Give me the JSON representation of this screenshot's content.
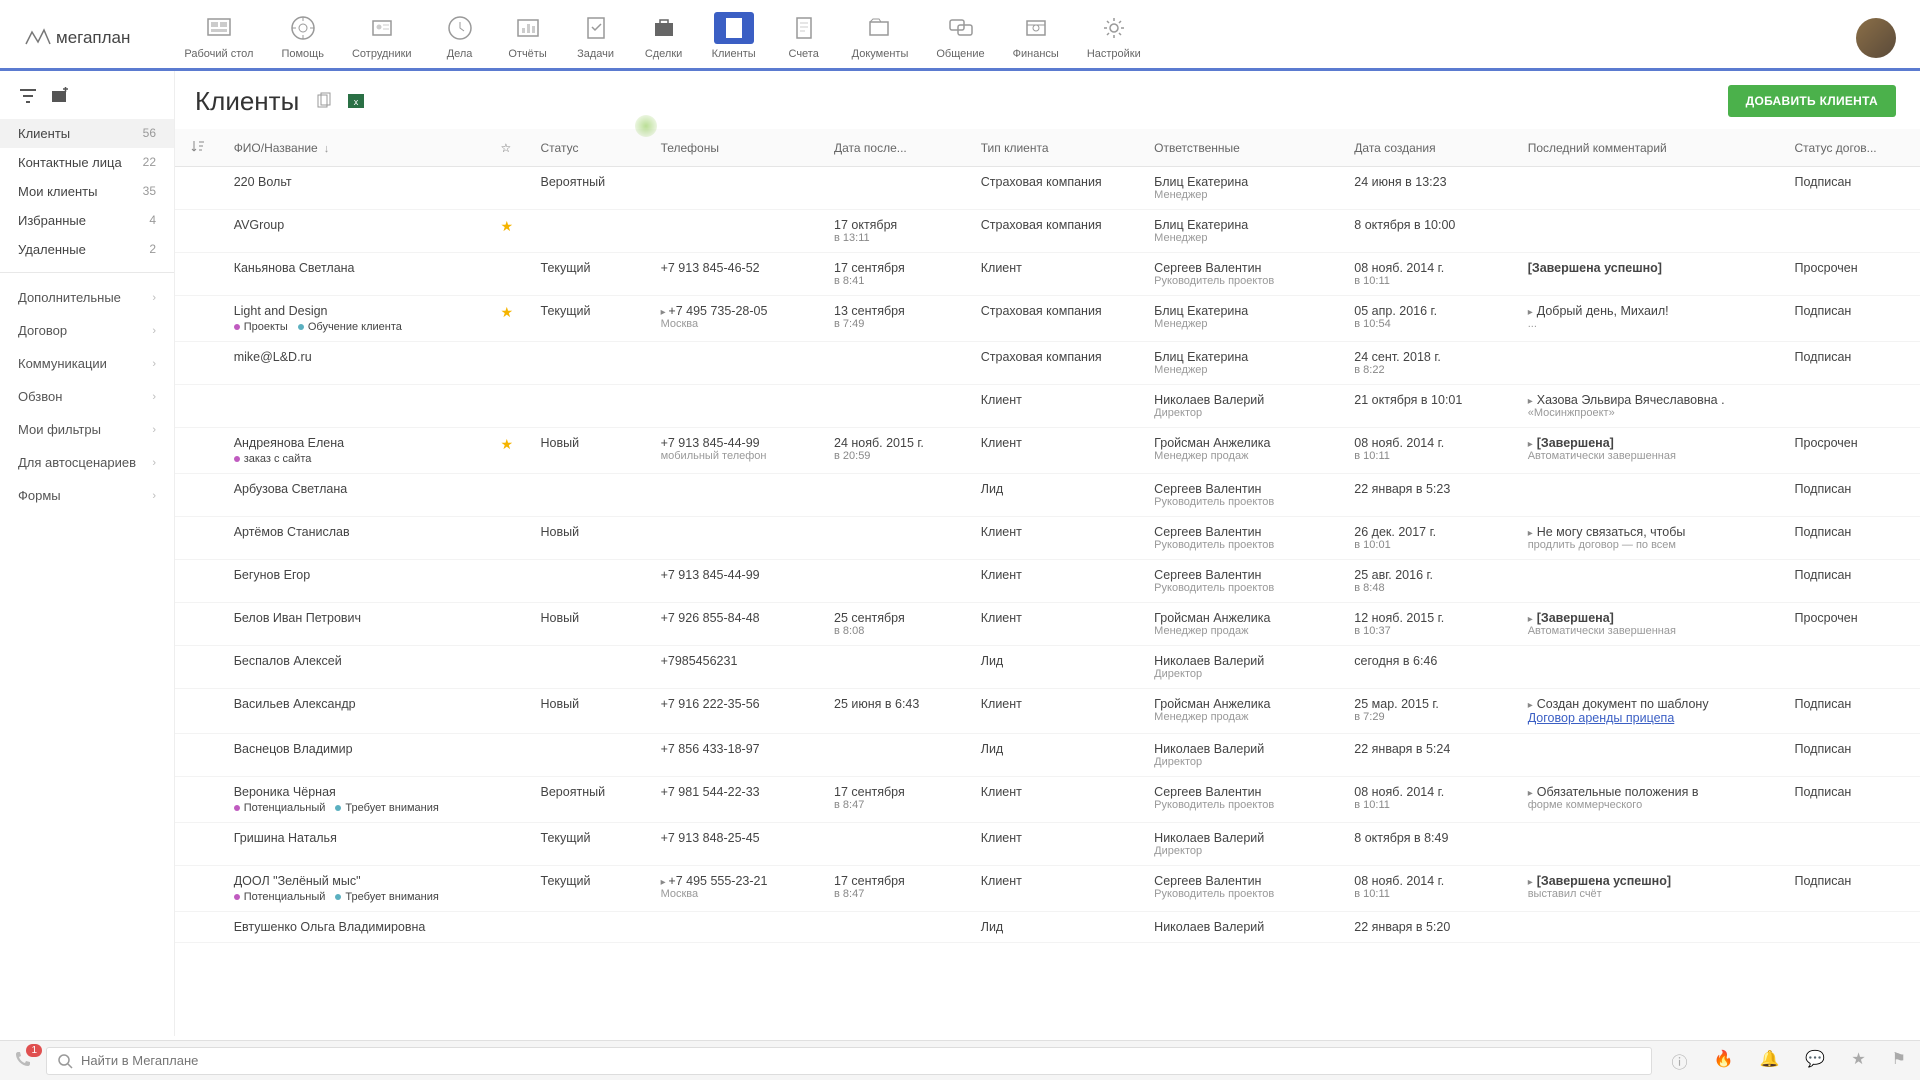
{
  "logo_text": "мегаплан",
  "nav": [
    {
      "id": "desktop",
      "label": "Рабочий стол"
    },
    {
      "id": "help",
      "label": "Помощь"
    },
    {
      "id": "staff",
      "label": "Сотрудники"
    },
    {
      "id": "todo",
      "label": "Дела"
    },
    {
      "id": "reports",
      "label": "Отчёты"
    },
    {
      "id": "tasks",
      "label": "Задачи"
    },
    {
      "id": "deals",
      "label": "Сделки"
    },
    {
      "id": "clients",
      "label": "Клиенты",
      "active": true
    },
    {
      "id": "invoices",
      "label": "Счета"
    },
    {
      "id": "docs",
      "label": "Документы"
    },
    {
      "id": "chat",
      "label": "Общение"
    },
    {
      "id": "finance",
      "label": "Финансы"
    },
    {
      "id": "settings",
      "label": "Настройки"
    }
  ],
  "sidebar": {
    "folders": [
      {
        "label": "Клиенты",
        "count": "56",
        "active": true
      },
      {
        "label": "Контактные лица",
        "count": "22"
      },
      {
        "label": "Мои клиенты",
        "count": "35"
      },
      {
        "label": "Избранные",
        "count": "4"
      },
      {
        "label": "Удаленные",
        "count": "2"
      }
    ],
    "filters": [
      {
        "label": "Дополнительные"
      },
      {
        "label": "Договор"
      },
      {
        "label": "Коммуникации"
      },
      {
        "label": "Обзвон"
      },
      {
        "label": "Мои фильтры"
      },
      {
        "label": "Для автосценариев"
      },
      {
        "label": "Формы"
      }
    ]
  },
  "page_title": "Клиенты",
  "add_button": "ДОБАВИТЬ КЛИЕНТА",
  "columns": {
    "name": "ФИО/Название",
    "status": "Статус",
    "phone": "Телефоны",
    "last": "Дата после...",
    "type": "Тип клиента",
    "resp": "Ответственные",
    "created": "Дата создания",
    "comment": "Последний комментарий",
    "contract": "Статус догов..."
  },
  "rows": [
    {
      "name": "220 Вольт",
      "status": "Вероятный",
      "type": "Страховая компания",
      "resp": "Блиц Екатерина",
      "resp_sub": "Менеджер",
      "created": "24 июня в 13:23",
      "contract": "Подписан"
    },
    {
      "name": "AVGroup",
      "star": true,
      "last": "17 октября",
      "last_sub": "в 13:11",
      "type": "Страховая компания",
      "resp": "Блиц Екатерина",
      "resp_sub": "Менеджер",
      "created": "8 октября в 10:00"
    },
    {
      "name": "Каньянова Светлана",
      "status": "Текущий",
      "phone": "+7 913 845-46-52",
      "last": "17 сентября",
      "last_sub": "в 8:41",
      "type": "Клиент",
      "resp": "Сергеев Валентин",
      "resp_sub": "Руководитель проектов",
      "created": "08 нояб. 2014 г.",
      "created_sub": "в 10:11",
      "comment": "[Завершена успешно]",
      "bold_comment": true,
      "contract": "Просрочен"
    },
    {
      "name": "Light and Design",
      "tags": [
        {
          "t": "Проекты",
          "c": "#c05bc0"
        },
        {
          "t": "Обучение клиента",
          "c": "#5bb0c0"
        }
      ],
      "star": true,
      "status": "Текущий",
      "phone": "+7 495 735-28-05",
      "phone_sub": "Москва",
      "phone_arrow": true,
      "last": "13 сентября",
      "last_sub": "в 7:49",
      "type": "Страховая компания",
      "resp": "Блиц Екатерина",
      "resp_sub": "Менеджер",
      "created": "05 апр. 2016 г.",
      "created_sub": "в 10:54",
      "comment": "Добрый день, Михаил!",
      "comment_sub": "...",
      "arrow": true,
      "contract": "Подписан"
    },
    {
      "name": "mike@L&D.ru",
      "type": "Страховая компания",
      "resp": "Блиц Екатерина",
      "resp_sub": "Менеджер",
      "created": "24 сент. 2018 г.",
      "created_sub": "в 8:22",
      "contract": "Подписан"
    },
    {
      "name": "",
      "type": "Клиент",
      "resp": "Николаев Валерий",
      "resp_sub": "Директор",
      "created": "21 октября в 10:01",
      "comment": "Хазова Эльвира Вячеславовна   .",
      "comment_sub": "«Мосинжпроект»",
      "arrow": true
    },
    {
      "name": "Андреянова Елена",
      "tags": [
        {
          "t": "заказ с сайта",
          "c": "#c05bc0"
        }
      ],
      "star": true,
      "status": "Новый",
      "phone": "+7 913 845-44-99",
      "phone_sub": "мобильный телефон",
      "last": "24 нояб. 2015 г.",
      "last_sub": "в 20:59",
      "type": "Клиент",
      "resp": "Гройсман Анжелика",
      "resp_sub": "Менеджер продаж",
      "created": "08 нояб. 2014 г.",
      "created_sub": "в 10:11",
      "comment": "[Завершена]",
      "comment_sub": "Автоматически завершенная",
      "bold_comment": true,
      "arrow": true,
      "contract": "Просрочен"
    },
    {
      "name": "Арбузова Светлана",
      "type": "Лид",
      "resp": "Сергеев Валентин",
      "resp_sub": "Руководитель проектов",
      "created": "22 января в 5:23",
      "contract": "Подписан"
    },
    {
      "name": "Артёмов Станислав",
      "status": "Новый",
      "type": "Клиент",
      "resp": "Сергеев Валентин",
      "resp_sub": "Руководитель проектов",
      "created": "26 дек. 2017 г.",
      "created_sub": "в 10:01",
      "comment": "Не могу связаться, чтобы",
      "comment_sub": "продлить договор — по всем",
      "arrow": true,
      "contract": "Подписан"
    },
    {
      "name": "Бегунов Егор",
      "phone": "+7 913 845-44-99",
      "type": "Клиент",
      "resp": "Сергеев Валентин",
      "resp_sub": "Руководитель проектов",
      "created": "25 авг. 2016 г.",
      "created_sub": "в 8:48",
      "contract": "Подписан"
    },
    {
      "name": "Белов Иван Петрович",
      "status": "Новый",
      "phone": "+7 926 855-84-48",
      "last": "25 сентября",
      "last_sub": "в 8:08",
      "type": "Клиент",
      "resp": "Гройсман Анжелика",
      "resp_sub": "Менеджер продаж",
      "created": "12 нояб. 2015 г.",
      "created_sub": "в 10:37",
      "comment": "[Завершена]",
      "comment_sub": "Автоматически завершенная",
      "bold_comment": true,
      "arrow": true,
      "contract": "Просрочен"
    },
    {
      "name": "Беспалов Алексей",
      "phone": "+7985456231",
      "type": "Лид",
      "resp": "Николаев Валерий",
      "resp_sub": "Директор",
      "created": "сегодня в 6:46"
    },
    {
      "name": "Васильев Александр",
      "status": "Новый",
      "phone": "+7 916 222-35-56",
      "last": "25 июня в 6:43",
      "type": "Клиент",
      "resp": "Гройсман Анжелика",
      "resp_sub": "Менеджер продаж",
      "created": "25 мар. 2015 г.",
      "created_sub": "в 7:29",
      "comment": "Создан документ по шаблону",
      "link": "Договор аренды прицепа",
      "arrow": true,
      "contract": "Подписан"
    },
    {
      "name": "Васнецов Владимир",
      "phone": "+7 856 433-18-97",
      "type": "Лид",
      "resp": "Николаев Валерий",
      "resp_sub": "Директор",
      "created": "22 января в 5:24",
      "contract": "Подписан"
    },
    {
      "name": "Вероника Чёрная",
      "tags": [
        {
          "t": "Потенциальный",
          "c": "#c05bc0"
        },
        {
          "t": "Требует внимания",
          "c": "#5bb0c0"
        }
      ],
      "status": "Вероятный",
      "phone": "+7 981 544-22-33",
      "last": "17 сентября",
      "last_sub": "в 8:47",
      "type": "Клиент",
      "resp": "Сергеев Валентин",
      "resp_sub": "Руководитель проектов",
      "created": "08 нояб. 2014 г.",
      "created_sub": "в 10:11",
      "comment": "Обязательные положения в",
      "comment_sub": "форме коммерческого",
      "arrow": true,
      "contract": "Подписан"
    },
    {
      "name": "Гришина Наталья",
      "status": "Текущий",
      "phone": "+7 913 848-25-45",
      "type": "Клиент",
      "resp": "Николаев Валерий",
      "resp_sub": "Директор",
      "created": "8 октября в 8:49"
    },
    {
      "name": "ДООЛ \"Зелёный мыс\"",
      "tags": [
        {
          "t": "Потенциальный",
          "c": "#c05bc0"
        },
        {
          "t": "Требует внимания",
          "c": "#5bb0c0"
        }
      ],
      "status": "Текущий",
      "phone": "+7 495 555-23-21",
      "phone_sub": "Москва",
      "phone_arrow": true,
      "last": "17 сентября",
      "last_sub": "в 8:47",
      "type": "Клиент",
      "resp": "Сергеев Валентин",
      "resp_sub": "Руководитель проектов",
      "created": "08 нояб. 2014 г.",
      "created_sub": "в 10:11",
      "comment": "[Завершена успешно]",
      "comment_sub": "выставил счёт",
      "bold_comment": true,
      "arrow": true,
      "contract": "Подписан"
    },
    {
      "name": "Евтушенко Ольга Владимировна",
      "type": "Лид",
      "resp": "Николаев Валерий",
      "created": "22 января в 5:20"
    }
  ],
  "search_placeholder": "Найти в Мегаплане",
  "phone_badge": "1"
}
